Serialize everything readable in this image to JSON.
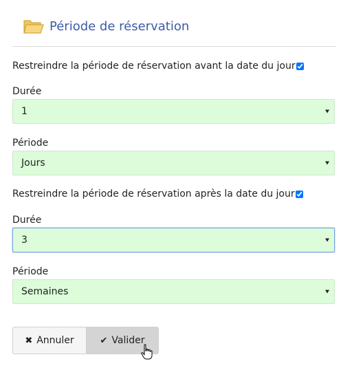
{
  "header": {
    "title": "Période de réservation",
    "icon": "folder-open-icon"
  },
  "section_before": {
    "restrict_label": "Restreindre la période de réservation avant la date du jour",
    "restrict_checked": true,
    "duration_label": "Durée",
    "duration_value": "1",
    "period_label": "Période",
    "period_value": "Jours"
  },
  "section_after": {
    "restrict_label": "Restreindre la période de réservation après la date du jour",
    "restrict_checked": true,
    "duration_label": "Durée",
    "duration_value": "3",
    "period_label": "Période",
    "period_value": "Semaines"
  },
  "actions": {
    "cancel_label": "Annuler",
    "cancel_icon": "close-icon",
    "submit_label": "Valider",
    "submit_icon": "check-icon"
  },
  "colors": {
    "title": "#3d5aa8",
    "select_bg": "#dcfcda",
    "focus_border": "#6f9ee0"
  }
}
